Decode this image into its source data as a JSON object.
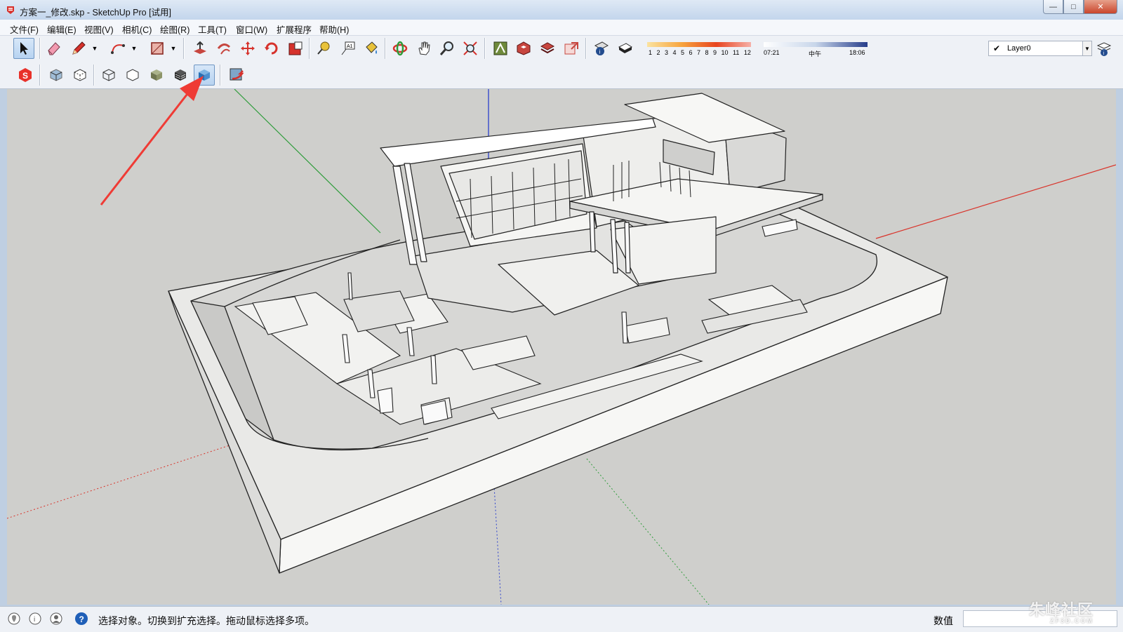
{
  "window": {
    "title": "方案一_修改.skp - SketchUp Pro [试用]",
    "buttons": [
      "minimize",
      "maximize",
      "close"
    ]
  },
  "menu": {
    "items": [
      "文件(F)",
      "编辑(E)",
      "视图(V)",
      "相机(C)",
      "绘图(R)",
      "工具(T)",
      "窗口(W)",
      "扩展程序",
      "帮助(H)"
    ]
  },
  "toolbar": {
    "row1_tools": [
      "select",
      "eraser",
      "pencil",
      "arc",
      "rectangle",
      "push-pull",
      "offset",
      "move",
      "rotate",
      "scale",
      "tape-measure",
      "text",
      "paint-bucket",
      "orbit",
      "pan",
      "zoom",
      "zoom-extents",
      "3d-warehouse",
      "extension-warehouse",
      "layout",
      "send-to-layout",
      "model-info",
      "components"
    ],
    "row2_tools": [
      "sketchup-icon",
      "xray",
      "back-edges",
      "wireframe",
      "hidden-line",
      "shaded",
      "shaded-with-textures",
      "monochrome",
      "styles-update"
    ],
    "active_tool": "monochrome",
    "shadow_scale": [
      "1",
      "2",
      "3",
      "4",
      "5",
      "6",
      "7",
      "8",
      "9",
      "10",
      "11",
      "12"
    ],
    "time_start": "07:21",
    "time_mid": "中午",
    "time_end": "18:06",
    "layer": "Layer0"
  },
  "statusbar": {
    "message": "选择对象。切换到扩充选择。拖动鼠标选择多项。",
    "value_label": "数值",
    "value": ""
  },
  "watermark": {
    "text": "朱峰社区",
    "subtext": "ZF3D.COM"
  },
  "colors": {
    "axis_red": "#d9342b",
    "axis_green": "#2e9c3a",
    "axis_blue": "#2b3fcc",
    "annotation_arrow": "#ef3b35",
    "viewport_bg": "#cfcfcc"
  }
}
